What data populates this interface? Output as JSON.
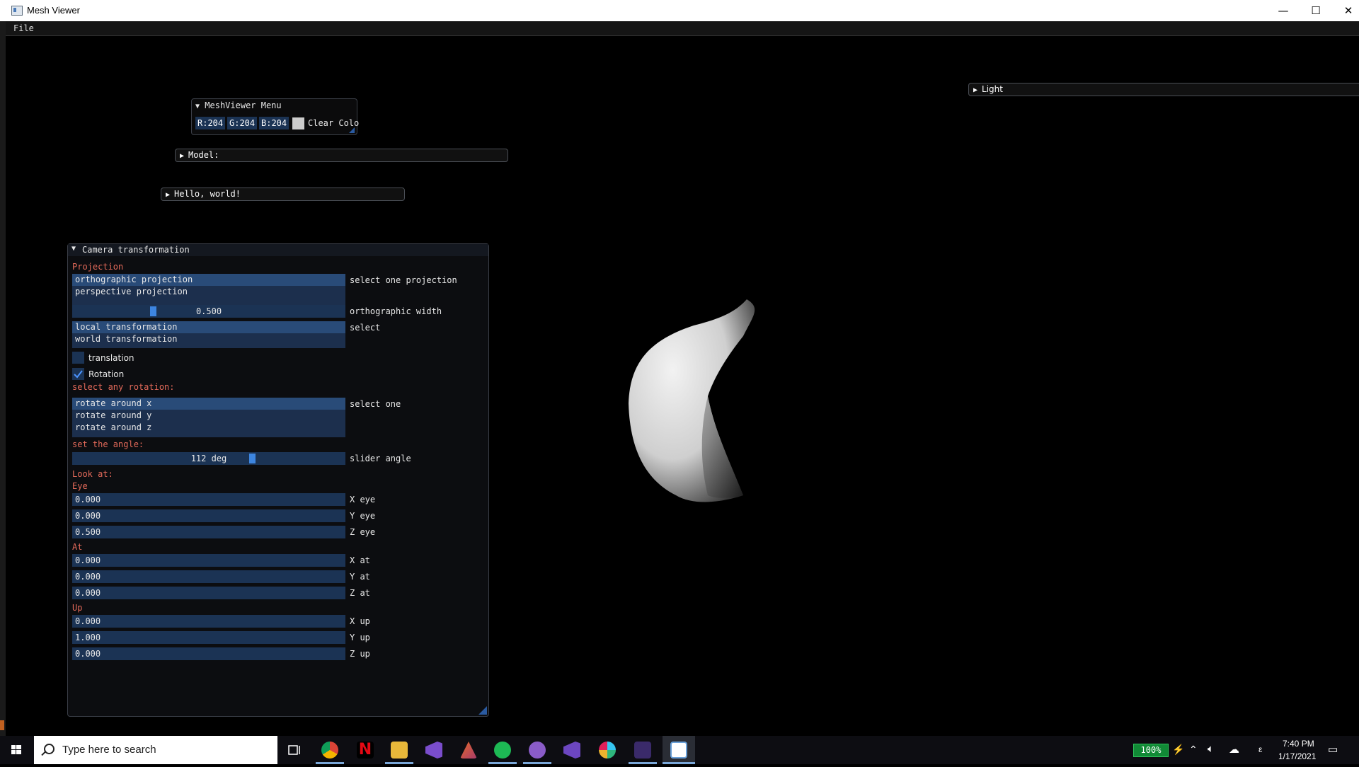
{
  "window": {
    "title": "Mesh Viewer",
    "minimize": "—",
    "maximize": "☐",
    "close": "✕"
  },
  "menubar": {
    "file": "File"
  },
  "meshviewer_menu": {
    "title": "MeshViewer Menu",
    "r": "R:204",
    "g": "G:204",
    "b": "B:204",
    "clear_color_label": "Clear Colo",
    "swatch_color": "#cccccc"
  },
  "model_header": "Model:",
  "hello_header": "Hello, world!",
  "light_header": "Light",
  "camera": {
    "title": "Camera transformation",
    "projection_heading": "Projection",
    "projection_options": [
      "orthographic projection",
      "perspective projection"
    ],
    "projection_selected": 0,
    "projection_label": "select one projection",
    "ortho_width_value": "0.500",
    "ortho_width_level": 0.28,
    "ortho_width_label": "orthographic width",
    "transform_options": [
      "local transformation",
      "world transformation"
    ],
    "transform_selected": 0,
    "transform_label": "select",
    "translation_label": "translation",
    "translation_checked": false,
    "rotation_label": "Rotation",
    "rotation_checked": true,
    "rotation_heading": "select any rotation:",
    "rotation_options": [
      "rotate around x",
      "rotate around y",
      "rotate around z"
    ],
    "rotation_selected": 0,
    "rotation_select_label": "select one",
    "angle_heading": "set the angle:",
    "angle_value": "112 deg",
    "angle_level": 0.65,
    "angle_label": "slider angle",
    "lookat_heading": "Look at:",
    "eye_heading": "Eye",
    "eye": [
      {
        "value": "0.000",
        "label": "X eye"
      },
      {
        "value": "0.000",
        "label": "Y eye"
      },
      {
        "value": "0.500",
        "label": "Z eye"
      }
    ],
    "at_heading": "At",
    "at": [
      {
        "value": "0.000",
        "label": "X at"
      },
      {
        "value": "0.000",
        "label": "Y at"
      },
      {
        "value": "0.000",
        "label": "Z at"
      }
    ],
    "up_heading": "Up",
    "up": [
      {
        "value": "0.000",
        "label": "X up"
      },
      {
        "value": "1.000",
        "label": "Y up"
      },
      {
        "value": "0.000",
        "label": "Z up"
      }
    ]
  },
  "taskbar": {
    "search_placeholder": "Type here to search",
    "battery": "100%",
    "time": "7:40 PM",
    "date": "1/17/2021",
    "lang": "ε",
    "apps": [
      "task-view",
      "chrome",
      "netflix",
      "file-explorer",
      "visual-studio",
      "matlab",
      "spotify",
      "github-desktop",
      "visual-studio-2",
      "slack",
      "terminal",
      "mesh-viewer"
    ]
  },
  "colors": {
    "accent": "#3d85e0",
    "list_bg": "#1c2f4d",
    "selected": "#294b78",
    "heading_red": "#e46a5a"
  }
}
